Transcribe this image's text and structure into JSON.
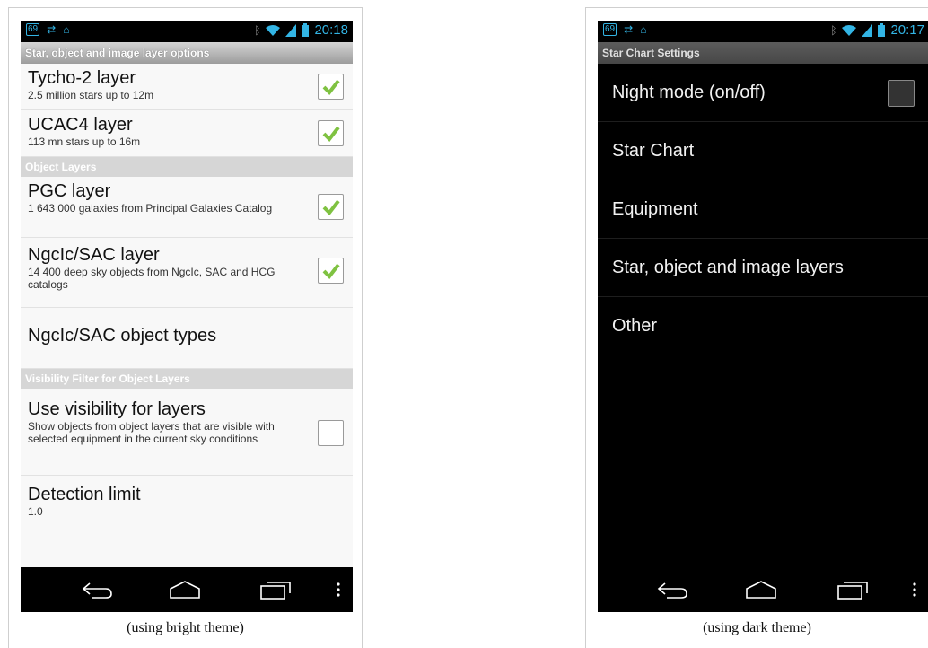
{
  "bright": {
    "status": {
      "badge": "69",
      "time": "20:18"
    },
    "title": "Star, object and image layer options",
    "items": [
      {
        "title": "Tycho-2 layer",
        "summary": "2.5 million stars up to 12m",
        "checked": true
      },
      {
        "title": "UCAC4 layer",
        "summary": "113 mn stars up to 16m",
        "checked": true
      }
    ],
    "section_object": "Object Layers",
    "object_items": [
      {
        "title": "PGC layer",
        "summary": "1 643 000 galaxies from Principal Galaxies Catalog",
        "checked": true
      },
      {
        "title": "NgcIc/SAC layer",
        "summary": "14 400 deep sky objects from NgcIc, SAC and HCG catalogs",
        "checked": true
      },
      {
        "title": "NgcIc/SAC object types"
      }
    ],
    "section_visibility": "Visibility Filter for Object Layers",
    "visibility_items": [
      {
        "title": "Use visibility for layers",
        "summary": "Show objects from object layers that are visible with selected equipment in the current sky conditions",
        "checked": false
      },
      {
        "title": "Detection limit",
        "summary": "1.0"
      }
    ],
    "caption": "(using bright theme)"
  },
  "dark": {
    "status": {
      "badge": "69",
      "time": "20:17"
    },
    "title": "Star Chart Settings",
    "items": [
      {
        "title": "Night mode (on/off)",
        "checked": false
      },
      {
        "title": "Star Chart"
      },
      {
        "title": "Equipment"
      },
      {
        "title": "Star, object and image layers"
      },
      {
        "title": "Other"
      }
    ],
    "caption": "(using dark theme)"
  },
  "colors": {
    "accent": "#33b5e5",
    "check": "#7fc241"
  },
  "icons": [
    "back-icon",
    "home-icon",
    "recent-apps-icon",
    "overflow-menu-icon",
    "wifi-icon",
    "battery-icon",
    "signal-icon",
    "bluetooth-icon"
  ]
}
